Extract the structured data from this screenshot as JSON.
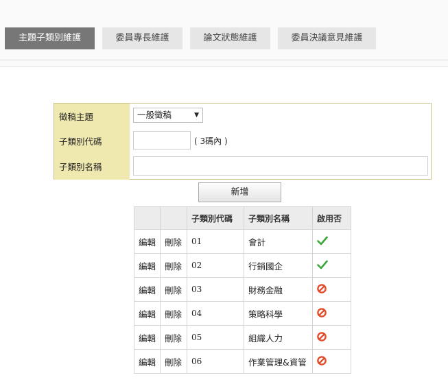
{
  "tabs": [
    {
      "label": "主題子類別維護",
      "active": true
    },
    {
      "label": "委員專長維護",
      "active": false
    },
    {
      "label": "論文狀態維護",
      "active": false
    },
    {
      "label": "委員決議意見維護",
      "active": false
    }
  ],
  "form": {
    "topic_label": "徵稿主題",
    "topic_value": "一般徵稿",
    "code_label": "子類別代碼",
    "code_hint": "( 3碼內 )",
    "code_value": "",
    "name_label": "子類別名稱",
    "name_value": ""
  },
  "add_button": "新增",
  "table": {
    "headers": [
      "",
      "",
      "子類別代碼",
      "子類別名稱",
      "啟用否"
    ],
    "edit_label": "編輯",
    "delete_label": "刪除",
    "rows": [
      {
        "code": "01",
        "name": "會計",
        "enabled": true
      },
      {
        "code": "02",
        "name": "行銷國企",
        "enabled": true
      },
      {
        "code": "03",
        "name": "財務金融",
        "enabled": false
      },
      {
        "code": "04",
        "name": "策略科學",
        "enabled": false
      },
      {
        "code": "05",
        "name": "組織人力",
        "enabled": false
      },
      {
        "code": "06",
        "name": "作業管理&資管",
        "enabled": false
      }
    ]
  },
  "icons": {
    "enabled": "check-icon",
    "disabled": "prohibited-icon"
  },
  "colors": {
    "tab_active": "#777777",
    "tab_inactive": "#e6e6e6",
    "form_label_bg": "#efe9b0",
    "check": "#3aa63a",
    "prohibited": "#e34b2a"
  }
}
